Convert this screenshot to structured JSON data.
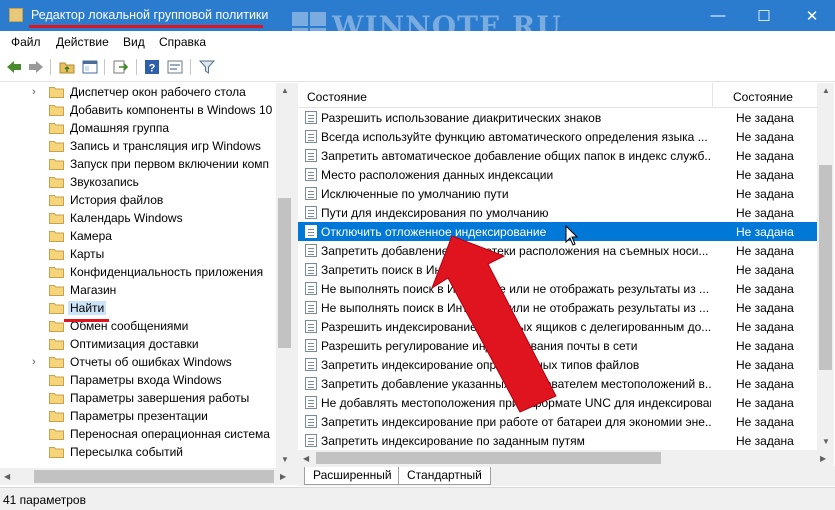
{
  "window": {
    "title": "Редактор локальной групповой политики",
    "controls": {
      "minimize": "—",
      "maximize": "☐",
      "close": "✕"
    }
  },
  "watermark": {
    "text": "WINNOTE.RU"
  },
  "menu": [
    "Файл",
    "Действие",
    "Вид",
    "Справка"
  ],
  "toolbar": {
    "buttons": [
      "back-icon",
      "forward-icon",
      "up-folder-icon",
      "show-tree-icon",
      "export-icon",
      "help-icon",
      "properties-icon",
      "filter-icon"
    ]
  },
  "tree": {
    "items": [
      {
        "label": "Диспетчер окон рабочего стола",
        "expandable": true
      },
      {
        "label": "Добавить компоненты в Windows 10",
        "expandable": false
      },
      {
        "label": "Домашняя группа",
        "expandable": false
      },
      {
        "label": "Запись и трансляция игр Windows",
        "expandable": false
      },
      {
        "label": "Запуск при первом включении комп",
        "expandable": false
      },
      {
        "label": "Звукозапись",
        "expandable": false
      },
      {
        "label": "История файлов",
        "expandable": false
      },
      {
        "label": "Календарь Windows",
        "expandable": false
      },
      {
        "label": "Камера",
        "expandable": false
      },
      {
        "label": "Карты",
        "expandable": false
      },
      {
        "label": "Конфиденциальность приложения",
        "expandable": false
      },
      {
        "label": "Магазин",
        "expandable": false
      },
      {
        "label": "Найти",
        "expandable": false,
        "selected": true
      },
      {
        "label": "Обмен сообщениями",
        "expandable": false
      },
      {
        "label": "Оптимизация доставки",
        "expandable": false
      },
      {
        "label": "Отчеты об ошибках Windows",
        "expandable": true
      },
      {
        "label": "Параметры входа Windows",
        "expandable": false
      },
      {
        "label": "Параметры завершения работы",
        "expandable": false
      },
      {
        "label": "Параметры презентации",
        "expandable": false
      },
      {
        "label": "Переносная операционная система",
        "expandable": false
      },
      {
        "label": "Пересылка событий",
        "expandable": false
      }
    ]
  },
  "list": {
    "columns": [
      "Состояние",
      "Состояние"
    ],
    "rows": [
      {
        "name": "Разрешить использование диакритических знаков",
        "state": "Не задана"
      },
      {
        "name": "Всегда используйте функцию автоматического определения языка ...",
        "state": "Не задана"
      },
      {
        "name": "Запретить автоматическое добавление общих папок в индекс служб...",
        "state": "Не задана"
      },
      {
        "name": "Место расположения данных индексации",
        "state": "Не задана"
      },
      {
        "name": "Исключенные по умолчанию пути",
        "state": "Не задана"
      },
      {
        "name": "Пути для индексирования по умолчанию",
        "state": "Не задана"
      },
      {
        "name": "Отключить отложенное индексирование",
        "state": "Не задана",
        "selected": true
      },
      {
        "name": "Запретить добавление библиотеки расположения на съемных носи...",
        "state": "Не задана"
      },
      {
        "name": "Запретить поиск в Интернете",
        "state": "Не задана"
      },
      {
        "name": "Не выполнять поиск в Интернете или не отображать результаты из ...",
        "state": "Не задана"
      },
      {
        "name": "Не выполнять поиск в Интернете или не отображать результаты из ...",
        "state": "Не задана"
      },
      {
        "name": "Разрешить индексирование почтовых ящиков с делегированным до...",
        "state": "Не задана"
      },
      {
        "name": "Разрешить регулирование индексирования почты в сети",
        "state": "Не задана"
      },
      {
        "name": "Запретить индексирование определенных типов файлов",
        "state": "Не задана"
      },
      {
        "name": "Запретить добавление указанных пользователем местоположений в...",
        "state": "Не задана"
      },
      {
        "name": "Не добавлять местоположения при в формате UNC для индексирования",
        "state": "Не задана"
      },
      {
        "name": "Запретить индексирование при работе от батареи для экономии эне...",
        "state": "Не задана"
      },
      {
        "name": "Запретить индексирование по заданным путям",
        "state": "Не задана"
      }
    ]
  },
  "tabs": [
    "Расширенный",
    "Стандартный"
  ],
  "status": {
    "text": "41 параметров"
  },
  "colors": {
    "titlebar": "#2b7bcf",
    "selection": "#0078d7",
    "annotation": "#e0141e"
  }
}
